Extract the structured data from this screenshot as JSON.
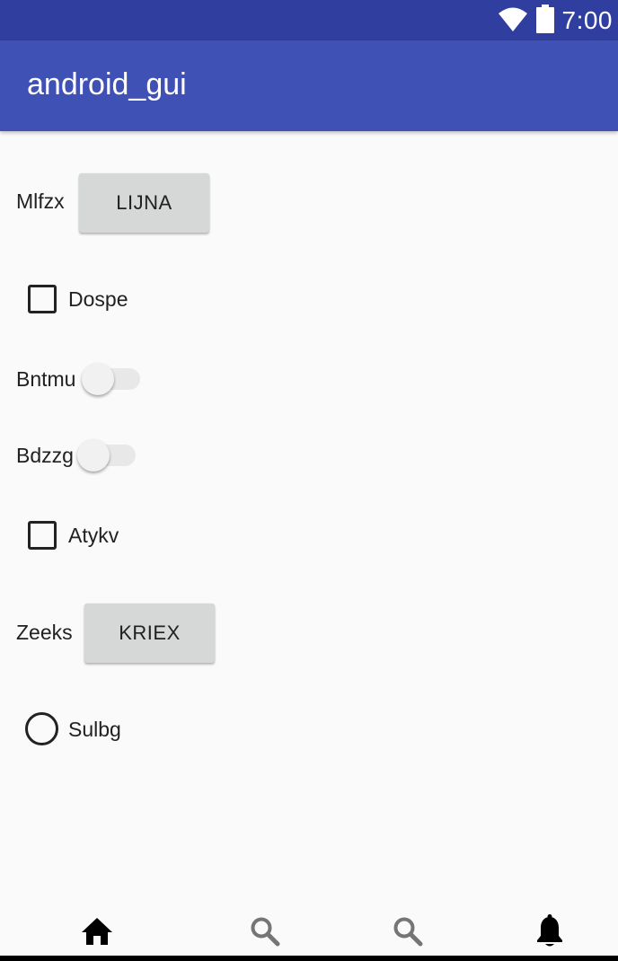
{
  "status_bar": {
    "time": "7:00",
    "icons": [
      "wifi-icon",
      "battery-icon"
    ]
  },
  "app_bar": {
    "title": "android_gui"
  },
  "rows": {
    "row1": {
      "label": "Mlfzx",
      "button": "LIJNA"
    },
    "row2": {
      "checkbox_label": "Dospe",
      "checked": false
    },
    "row3": {
      "switch_label": "Bntmu",
      "on": false
    },
    "row4": {
      "switch_label": "Bdzzg",
      "on": false
    },
    "row5": {
      "checkbox_label": "Atykv",
      "checked": false
    },
    "row6": {
      "label": "Zeeks",
      "button": "KRIEX"
    },
    "row7": {
      "radio_label": "Sulbg",
      "selected": false
    }
  },
  "bottom_nav": {
    "items": [
      "home-icon",
      "search-icon",
      "search-icon",
      "notifications-icon"
    ],
    "selected": "home-icon"
  },
  "colors": {
    "status_bar": "#303f9f",
    "app_bar": "#3f51b5",
    "background": "#fafafa",
    "button": "#d6d7d7"
  }
}
